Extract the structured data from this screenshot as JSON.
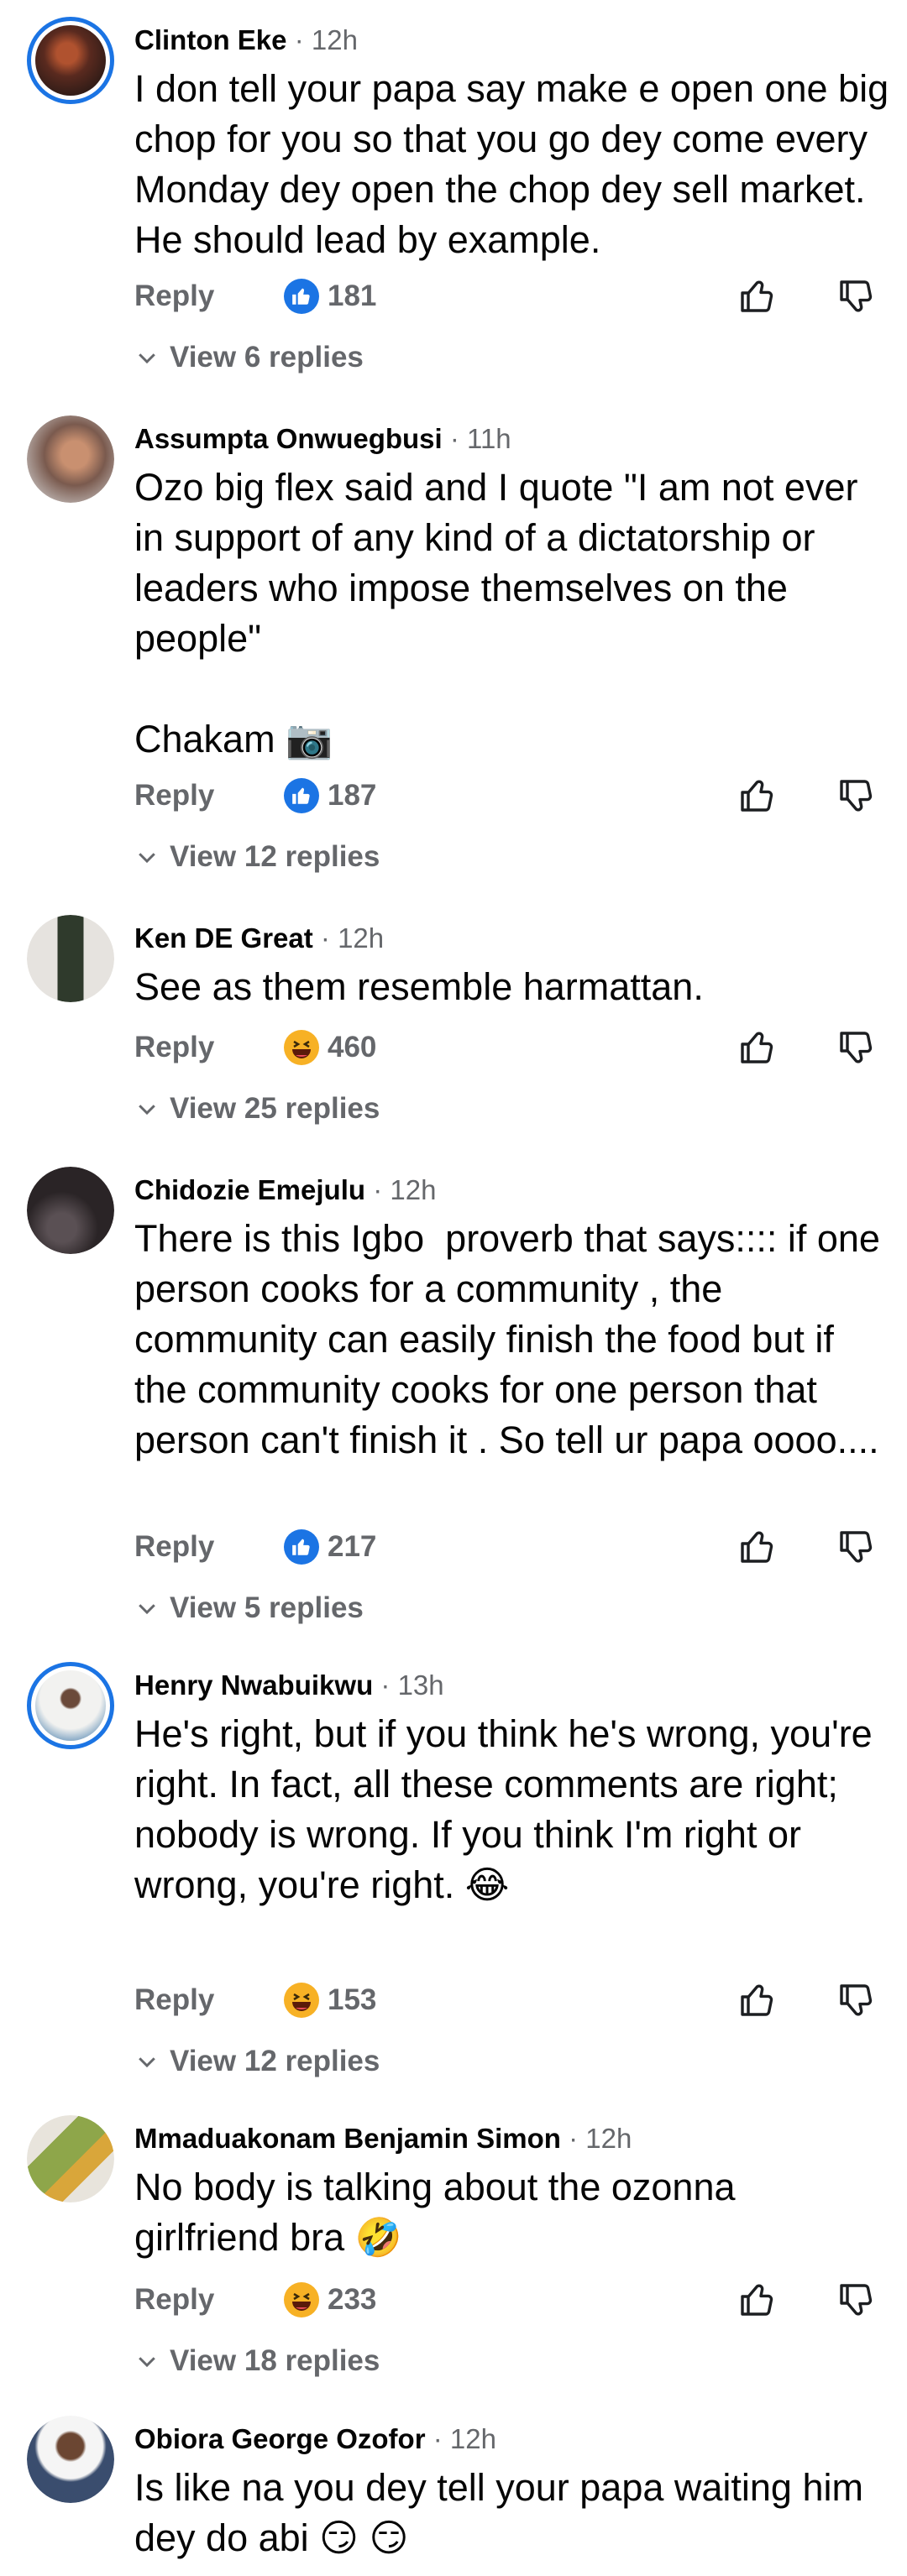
{
  "labels": {
    "reply": "Reply"
  },
  "colors": {
    "accent": "#1b74e4",
    "muted": "#65676b",
    "haha": "#f7b125"
  },
  "comments": [
    {
      "name": "Clinton Eke",
      "time": "· 12h",
      "text": [
        "I don tell your papa say make e open one big chop for you so that you go dey come every Monday dey open the chop dey sell market. He should lead by example."
      ],
      "reaction": "like",
      "count": "181",
      "view": "View 6 replies",
      "avatar_ring": true,
      "avatar_color": "#7a3b2a"
    },
    {
      "name": "Assumpta Onwuegbusi",
      "time": "· 11h",
      "text": [
        "Ozo big flex said and I quote \"I am not ever in support of any kind of a dictatorship or leaders who impose themselves on the people\"",
        "",
        "Chakam 📷"
      ],
      "reaction": "like",
      "count": "187",
      "view": "View 12 replies",
      "avatar_ring": false,
      "avatar_color": "#9a7b6a"
    },
    {
      "name": "Ken DE Great",
      "time": "· 12h",
      "text": [
        "See as them resemble harmattan."
      ],
      "reaction": "haha",
      "count": "460",
      "view": "View 25 replies",
      "avatar_ring": false,
      "avatar_color": "#d7d2cc"
    },
    {
      "name": "Chidozie Emejulu",
      "time": "· 12h",
      "text": [
        "There is this Igbo  proverb that says:::: if one person cooks for a community , the community can easily finish the food but if the community cooks for one person that person can't finish it . So tell ur papa oooo...."
      ],
      "reaction": "like",
      "count": "217",
      "view": "View 5 replies",
      "avatar_ring": false,
      "avatar_color": "#2a2426"
    },
    {
      "name": "Henry Nwabuikwu",
      "time": "· 13h",
      "text": [
        "He's right, but if you think he's wrong, you're right. In fact, all these comments are right; nobody is wrong. If you think I'm right or wrong, you're right. 😂"
      ],
      "reaction": "haha",
      "count": "153",
      "view": "View 12 replies",
      "avatar_ring": true,
      "avatar_color": "#c9d3dc"
    },
    {
      "name": "Mmaduakonam Benjamin Simon",
      "time": "· 12h",
      "text": [
        "No body is talking about the ozonna girlfriend bra 🤣"
      ],
      "reaction": "haha",
      "count": "233",
      "view": "View 18 replies",
      "avatar_ring": false,
      "avatar_color": "#8ea64a"
    },
    {
      "name": "Obiora George Ozofor",
      "time": "· 12h",
      "text": [
        "Is like na you dey tell your papa waiting him dey do abi 😏 😏"
      ],
      "avatar_ring": false,
      "avatar_color": "#5c6f8a"
    }
  ]
}
